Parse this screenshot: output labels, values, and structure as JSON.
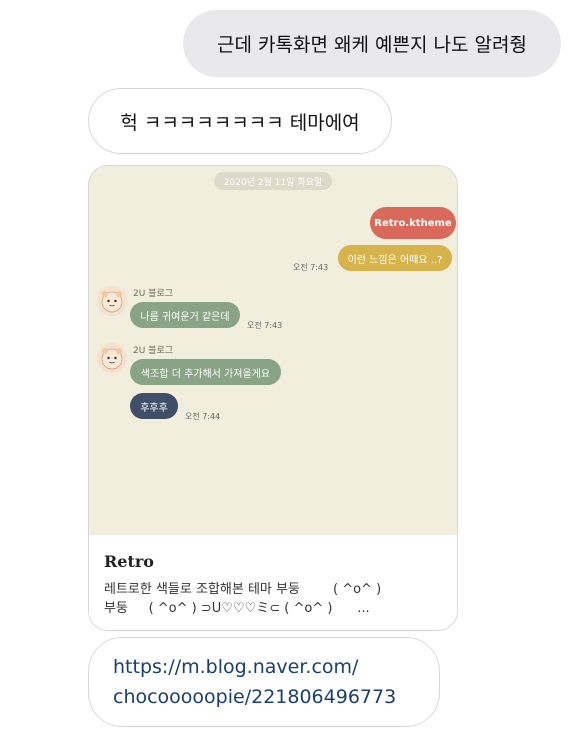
{
  "messages": {
    "outgoing_text": "근데 카톡화면 왜케 예쁜지 나도 알려줭",
    "incoming_text": "헉 ㅋㅋㅋㅋㅋㅋㅋㅋ 테마에여"
  },
  "preview": {
    "date": "2020년 2월 11일 화요일",
    "sent": [
      {
        "text": "Retro.ktheme",
        "color": "#d9695b"
      },
      {
        "text": "이런 느낌은 어때요 ..?",
        "color": "#d7b34c"
      }
    ],
    "sent_time": "오전 7:43",
    "sender_name": "2U 블로그",
    "received": [
      {
        "text": "나름 귀여운거 같은데",
        "time": "오전 7:43",
        "color": "#88a485"
      },
      {
        "text": "색조합 더 추가해서 가져올게요",
        "color": "#88a485"
      },
      {
        "text": "후후후",
        "time": "오전 7:44",
        "color": "#3f4f68"
      }
    ],
    "background": "#f1eedd"
  },
  "caption": {
    "title": "Retro",
    "line1": "레트로한 색들로 조합해본 테마 부둥        ( ^o^ )",
    "line2": "부둥     ( ^o^ ) ⊃U♡♡♡ミ⊂ ( ^o^ )      ..."
  },
  "link": {
    "line1": "https://m.blog.naver.com/",
    "line2": "chocooooopie/221806496773"
  }
}
